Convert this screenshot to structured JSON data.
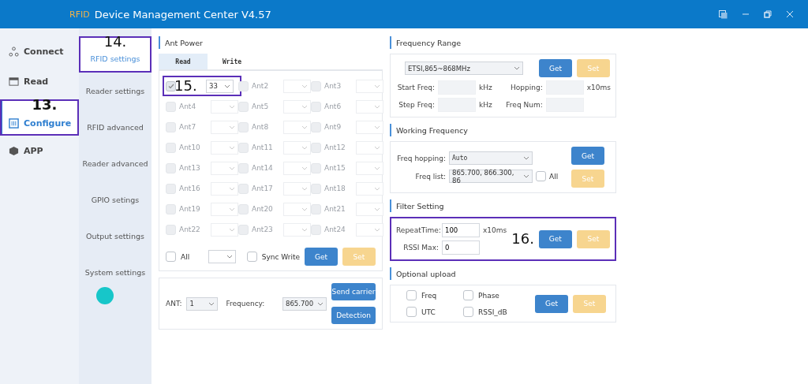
{
  "window": {
    "logo": "RFID",
    "title": "Device Management Center V4.57"
  },
  "nav": [
    {
      "label": "Connect",
      "selected": false
    },
    {
      "label": "Read",
      "selected": false
    },
    {
      "label": "Configure",
      "selected": true,
      "callout": "13."
    },
    {
      "label": "APP",
      "selected": false
    }
  ],
  "subnav": [
    {
      "label": "RFID settings",
      "selected": true,
      "callout": "14."
    },
    {
      "label": "Reader settings",
      "selected": false
    },
    {
      "label": "RFID advanced",
      "selected": false
    },
    {
      "label": "Reader advanced",
      "selected": false
    },
    {
      "label": "GPIO setings",
      "selected": false
    },
    {
      "label": "Output settings",
      "selected": false
    },
    {
      "label": "System settings",
      "selected": false
    }
  ],
  "ant_power": {
    "title": "Ant Power",
    "tabs": [
      {
        "label": "Read",
        "selected": true
      },
      {
        "label": "Write",
        "selected": false
      }
    ],
    "ants": [
      {
        "checked": true,
        "disabled": false,
        "value": "33",
        "callout": "15."
      },
      {
        "label": "Ant2",
        "checked": false,
        "disabled": true
      },
      {
        "label": "Ant3",
        "checked": false,
        "disabled": true
      },
      {
        "label": "Ant4",
        "checked": false,
        "disabled": true
      },
      {
        "label": "Ant5",
        "checked": false,
        "disabled": true
      },
      {
        "label": "Ant6",
        "checked": false,
        "disabled": true
      },
      {
        "label": "Ant7",
        "checked": false,
        "disabled": true
      },
      {
        "label": "Ant8",
        "checked": false,
        "disabled": true
      },
      {
        "label": "Ant9",
        "checked": false,
        "disabled": true
      },
      {
        "label": "Ant10",
        "checked": false,
        "disabled": true
      },
      {
        "label": "Ant11",
        "checked": false,
        "disabled": true
      },
      {
        "label": "Ant12",
        "checked": false,
        "disabled": true
      },
      {
        "label": "Ant13",
        "checked": false,
        "disabled": true
      },
      {
        "label": "Ant14",
        "checked": false,
        "disabled": true
      },
      {
        "label": "Ant15",
        "checked": false,
        "disabled": true
      },
      {
        "label": "Ant16",
        "checked": false,
        "disabled": true
      },
      {
        "label": "Ant17",
        "checked": false,
        "disabled": true
      },
      {
        "label": "Ant18",
        "checked": false,
        "disabled": true
      },
      {
        "label": "Ant19",
        "checked": false,
        "disabled": true
      },
      {
        "label": "Ant20",
        "checked": false,
        "disabled": true
      },
      {
        "label": "Ant21",
        "checked": false,
        "disabled": true
      },
      {
        "label": "Ant22",
        "checked": false,
        "disabled": true
      },
      {
        "label": "Ant23",
        "checked": false,
        "disabled": true
      },
      {
        "label": "Ant24",
        "checked": false,
        "disabled": true
      }
    ],
    "all": {
      "label": "All",
      "checked": false
    },
    "sync": {
      "label": "Sync Write",
      "checked": false
    },
    "get": "Get",
    "set": "Set"
  },
  "carrier": {
    "ant_label": "ANT:",
    "ant_value": "1",
    "freq_label": "Frequency:",
    "freq_value": "865.700",
    "send": "Send carrier",
    "detect": "Detection"
  },
  "freq_range": {
    "title": "Frequency Range",
    "region": "ETSI,865~868MHz",
    "get": "Get",
    "set": "Set",
    "start_label": "Start Freq:",
    "start_unit": "kHz",
    "hop_label": "Hopping:",
    "hop_unit": "x10ms",
    "step_label": "Step Freq:",
    "step_unit": "kHz",
    "num_label": "Freq Num:"
  },
  "working": {
    "title": "Working Frequency",
    "hop_label": "Freq hopping:",
    "hop_value": "Auto",
    "list_label": "Freq list:",
    "list_value": "865.700, 866.300, 86",
    "all": {
      "label": "All",
      "checked": false
    },
    "get": "Get",
    "set": "Set"
  },
  "filter": {
    "title": "Filter Setting",
    "callout": "16.",
    "repeat_label": "RepeatTime:",
    "repeat_value": "100",
    "repeat_unit": "x10ms",
    "rssi_label": "RSSI Max:",
    "rssi_value": "0",
    "get": "Get",
    "set": "Set"
  },
  "upload": {
    "title": "Optional upload",
    "options": [
      {
        "label": "Freq",
        "checked": false
      },
      {
        "label": "Phase",
        "checked": false
      },
      {
        "label": "UTC",
        "checked": false
      },
      {
        "label": "RSSI_dB",
        "checked": false
      }
    ],
    "get": "Get",
    "set": "Set"
  }
}
